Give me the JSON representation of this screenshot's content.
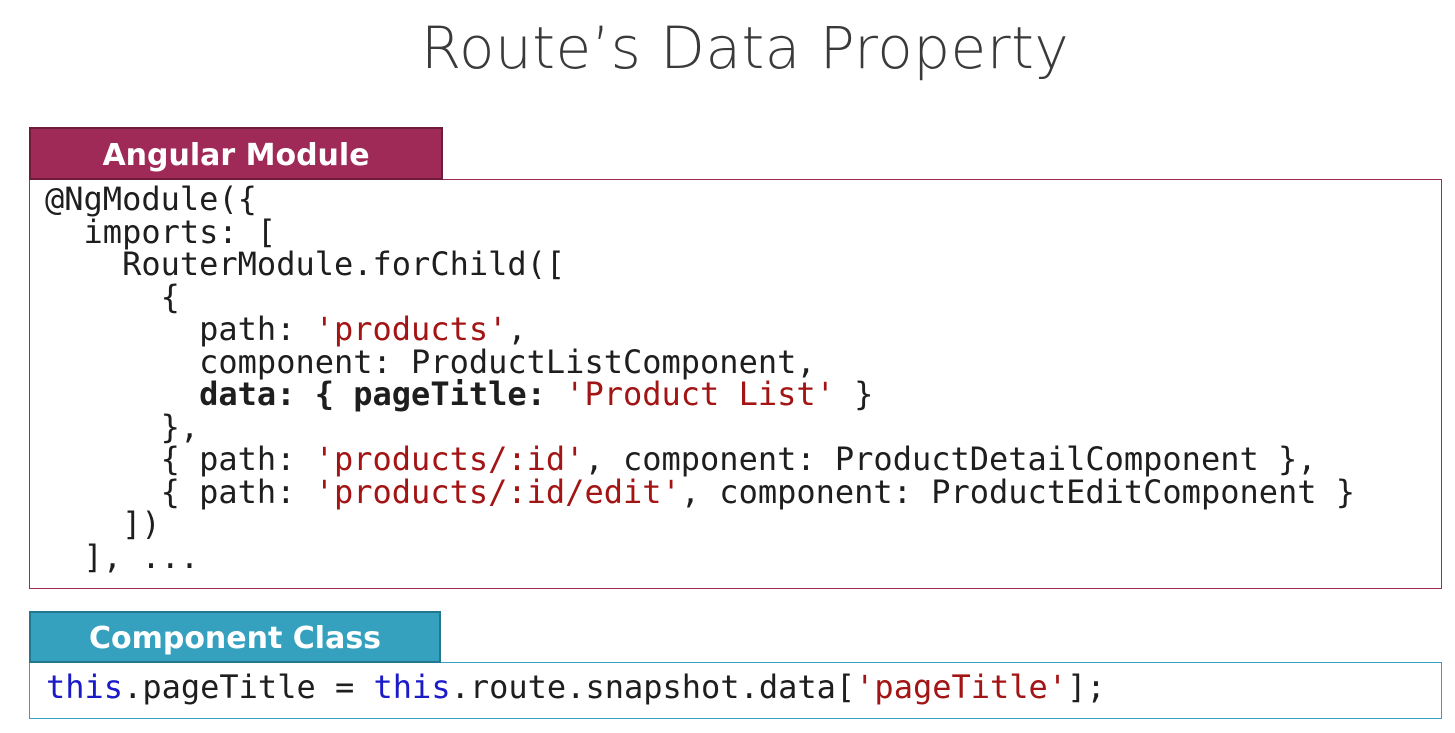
{
  "title": "Route’s Data Property",
  "module_section": {
    "tab_label": "Angular Module",
    "lines": [
      {
        "indent": "",
        "parts": [
          {
            "t": "@NgModule({"
          }
        ]
      },
      {
        "indent": "  ",
        "parts": [
          {
            "t": "imports: ["
          }
        ]
      },
      {
        "indent": "    ",
        "parts": [
          {
            "t": "RouterModule.forChild(["
          }
        ]
      },
      {
        "indent": "      ",
        "parts": [
          {
            "t": "{"
          }
        ]
      },
      {
        "indent": "        ",
        "parts": [
          {
            "t": "path: "
          },
          {
            "t": "'products'",
            "s": "str"
          },
          {
            "t": ","
          }
        ]
      },
      {
        "indent": "        ",
        "parts": [
          {
            "t": "component: ProductListComponent,"
          }
        ]
      },
      {
        "indent": "        ",
        "parts": [
          {
            "t": "data: { pageTitle: ",
            "s": "b"
          },
          {
            "t": "'Product List'",
            "s": "str"
          },
          {
            "t": " }"
          }
        ]
      },
      {
        "indent": "      ",
        "parts": [
          {
            "t": "},"
          }
        ]
      },
      {
        "indent": "      ",
        "parts": [
          {
            "t": "{ path: "
          },
          {
            "t": "'products/:id'",
            "s": "str"
          },
          {
            "t": ", component: ProductDetailComponent },"
          }
        ]
      },
      {
        "indent": "      ",
        "parts": [
          {
            "t": "{ path: "
          },
          {
            "t": "'products/:id/edit'",
            "s": "str"
          },
          {
            "t": ", component: ProductEditComponent }"
          }
        ]
      },
      {
        "indent": "    ",
        "parts": [
          {
            "t": "])"
          }
        ]
      },
      {
        "indent": "  ",
        "parts": [
          {
            "t": "], ..."
          }
        ]
      }
    ]
  },
  "component_section": {
    "tab_label": "Component Class",
    "lines": [
      {
        "indent": "",
        "parts": [
          {
            "t": "this",
            "s": "kw"
          },
          {
            "t": ".pageTitle = "
          },
          {
            "t": "this",
            "s": "kw"
          },
          {
            "t": ".route.snapshot.data["
          },
          {
            "t": "'pageTitle'",
            "s": "str"
          },
          {
            "t": "];"
          }
        ]
      }
    ]
  }
}
